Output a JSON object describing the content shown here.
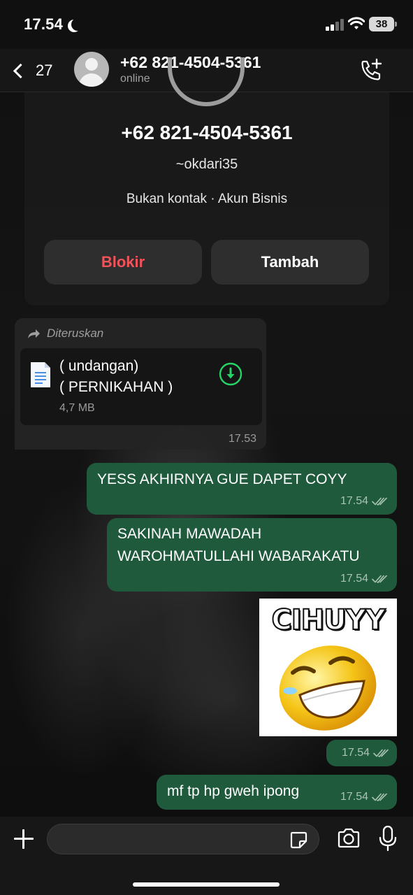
{
  "status_bar": {
    "time": "17.54",
    "battery": "38"
  },
  "header": {
    "back_count": "27",
    "contact_name": "+62 821-4504-5361",
    "contact_status": "online"
  },
  "contact_card": {
    "number": "+62 821-4504-5361",
    "username": "~okdari35",
    "tags": "Bukan kontak · Akun Bisnis",
    "block_label": "Blokir",
    "add_label": "Tambah"
  },
  "messages": [
    {
      "direction": "in",
      "forwarded_label": "Diteruskan",
      "doc_title_line1": "( undangan)",
      "doc_title_line2": "( PERNIKAHAN )",
      "doc_size": "4,7 MB",
      "time": "17.53"
    },
    {
      "direction": "out",
      "text": "YESS AKHIRNYA GUE DAPET COYY",
      "time": "17.54"
    },
    {
      "direction": "out",
      "text_line1": "SAKINAH MAWADAH",
      "text_line2": "WAROHMATULLAHI WABARAKATU",
      "time": "17.54"
    },
    {
      "direction": "out",
      "sticker_text": "CIHUYY",
      "time": "17.54"
    },
    {
      "direction": "out",
      "text": "mf tp hp gweh ipong",
      "time": "17.54"
    }
  ],
  "colors": {
    "outgoing_bubble": "#1e5a3b",
    "block_red": "#f0535a",
    "accent_green": "#25d366"
  }
}
